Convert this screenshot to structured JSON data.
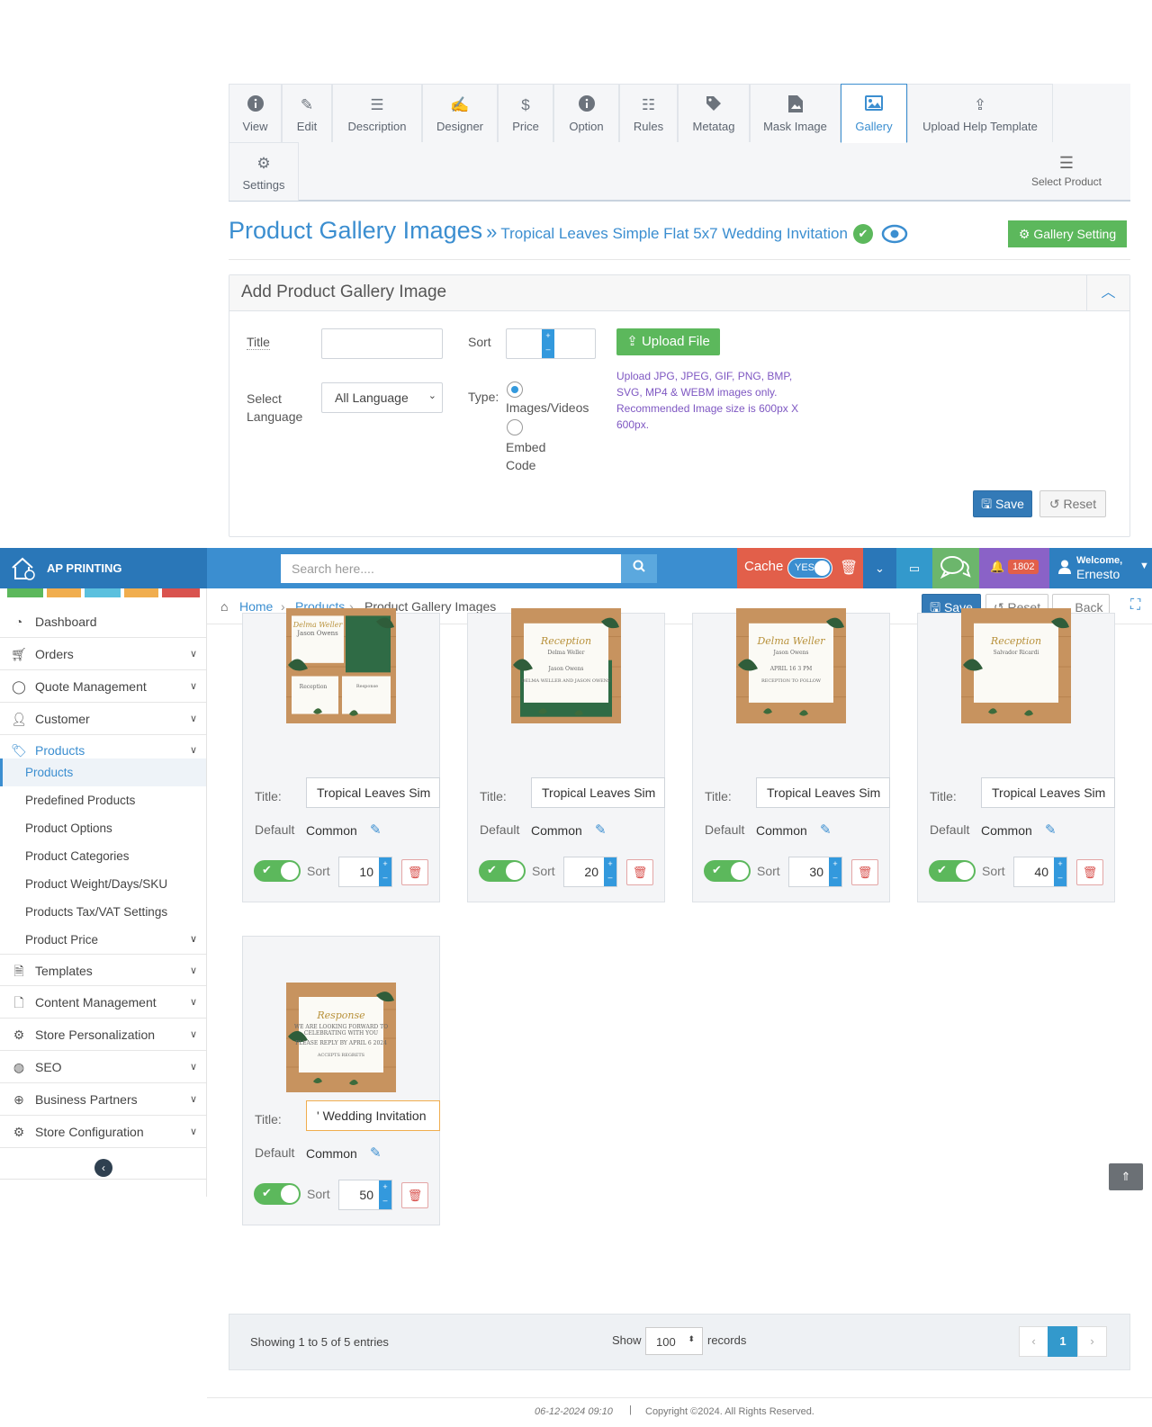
{
  "tabs": [
    {
      "label": "View",
      "icon": "info-icon"
    },
    {
      "label": "Edit",
      "icon": "pencil-icon"
    },
    {
      "label": "Description",
      "icon": "lines-icon"
    },
    {
      "label": "Designer",
      "icon": "edit-square-icon"
    },
    {
      "label": "Price",
      "icon": "dollar-icon"
    },
    {
      "label": "Option",
      "icon": "info-icon"
    },
    {
      "label": "Rules",
      "icon": "list-ol-icon"
    },
    {
      "label": "Metatag",
      "icon": "tag-icon"
    },
    {
      "label": "Mask Image",
      "icon": "file-image-icon"
    },
    {
      "label": "Gallery",
      "icon": "image-icon"
    },
    {
      "label": "Upload Help Template",
      "icon": "upload-icon"
    },
    {
      "label": "Settings",
      "icon": "gear-icon"
    }
  ],
  "select_product": "Select Product",
  "page": {
    "title": "Product Gallery Images",
    "sep": "»",
    "product": "Tropical Leaves Simple Flat 5x7 Wedding Invitation",
    "gallery_setting": "Gallery Setting"
  },
  "add_panel": {
    "heading": "Add Product Gallery Image",
    "title_label": "Title",
    "title_value": "",
    "sort_label": "Sort",
    "sort_value": "",
    "upload_label": "Upload File",
    "lang_label": "Select Language",
    "lang_value": "All Language",
    "type_label": "Type:",
    "type_opt1": "Images/Videos",
    "type_opt2": "Embed Code",
    "note": "Upload JPG, JPEG, GIF, PNG, BMP, SVG, MP4 & WEBM images only. Recommended Image size is 600px X 600px.",
    "save": "Save",
    "reset": "Reset"
  },
  "navbar": {
    "brand": "AP PRINTING",
    "search_placeholder": "Search here....",
    "cache": "Cache",
    "cache_toggle": "YES",
    "notif_count": "1802",
    "welcome": "Welcome,",
    "user": "Ernesto"
  },
  "sidebar": {
    "items": [
      {
        "label": "Dashboard",
        "icon": "dashboard-icon"
      },
      {
        "label": "Orders",
        "icon": "cart-icon"
      },
      {
        "label": "Quote Management",
        "icon": "chat-icon"
      },
      {
        "label": "Customer",
        "icon": "user-icon"
      },
      {
        "label": "Products",
        "icon": "tags-icon"
      }
    ],
    "products_sub": [
      "Products",
      "Predefined Products",
      "Product Options",
      "Product Categories",
      "Product Weight/Days/SKU",
      "Products Tax/VAT Settings",
      "Product Price"
    ],
    "items2": [
      {
        "label": "Templates",
        "icon": "pdf-icon"
      },
      {
        "label": "Content Management",
        "icon": "document-icon"
      },
      {
        "label": "Store Personalization",
        "icon": "gear-icon"
      },
      {
        "label": "SEO",
        "icon": "globe-icon"
      },
      {
        "label": "Business Partners",
        "icon": "crosshair-icon"
      },
      {
        "label": "Store Configuration",
        "icon": "gears-icon"
      }
    ]
  },
  "breadcrumb": {
    "home": "Home",
    "products": "Products",
    "current": "Product Gallery Images",
    "save": "Save",
    "reset": "Reset",
    "back": "Back"
  },
  "cards": [
    {
      "title": "Tropical Leaves Sim",
      "default_label": "Default",
      "default_value": "Common",
      "sort_label": "Sort",
      "sort": "10",
      "title_label": "Title:"
    },
    {
      "title": "Tropical Leaves Sim",
      "default_label": "Default",
      "default_value": "Common",
      "sort_label": "Sort",
      "sort": "20",
      "title_label": "Title:"
    },
    {
      "title": "Tropical Leaves Sim",
      "default_label": "Default",
      "default_value": "Common",
      "sort_label": "Sort",
      "sort": "30",
      "title_label": "Title:"
    },
    {
      "title": "Tropical Leaves Sim",
      "default_label": "Default",
      "default_value": "Common",
      "sort_label": "Sort",
      "sort": "40",
      "title_label": "Title:"
    },
    {
      "title": "' Wedding Invitation",
      "default_label": "Default",
      "default_value": "Common",
      "sort_label": "Sort",
      "sort": "50",
      "title_label": "Title:"
    }
  ],
  "card_thumbs": [
    {
      "text1": "Delma Weller",
      "text2": "Jason Owens",
      "text3": "Reception",
      "text4": "Response"
    },
    {
      "text1": "Reception",
      "text2": "Delma Weller",
      "text3": "Jason Owens",
      "text4": "DELMA WELLER AND JASON OWENS"
    },
    {
      "text1": "Delma Weller",
      "text2": "Jason Owens",
      "text3": "APRIL 16 3 PM",
      "text4": "RECEPTION TO FOLLOW"
    },
    {
      "text1": "Reception",
      "text2": "Salvador Ricardi",
      "text3": "",
      "text4": ""
    },
    {
      "text1": "Response",
      "text2": "WE ARE LOOKING FORWARD TO CELEBRATING WITH YOU",
      "text3": "PLEASE REPLY BY APRIL 6 2024",
      "text4": "ACCEPTS   REGRETS"
    }
  ],
  "pager": {
    "showing": "Showing 1 to 5 of 5 entries",
    "show": "Show",
    "records_value": "100",
    "records": "records",
    "page": "1"
  },
  "footer": {
    "date": "06-12-2024 09:10",
    "copyright": "Copyright ©2024. All Rights Reserved."
  },
  "colors": {
    "primary": "#3b8ed0",
    "success": "#5cb85c",
    "danger": "#d9534f",
    "cache": "#e25f4a",
    "notif": "#8a62c7"
  }
}
